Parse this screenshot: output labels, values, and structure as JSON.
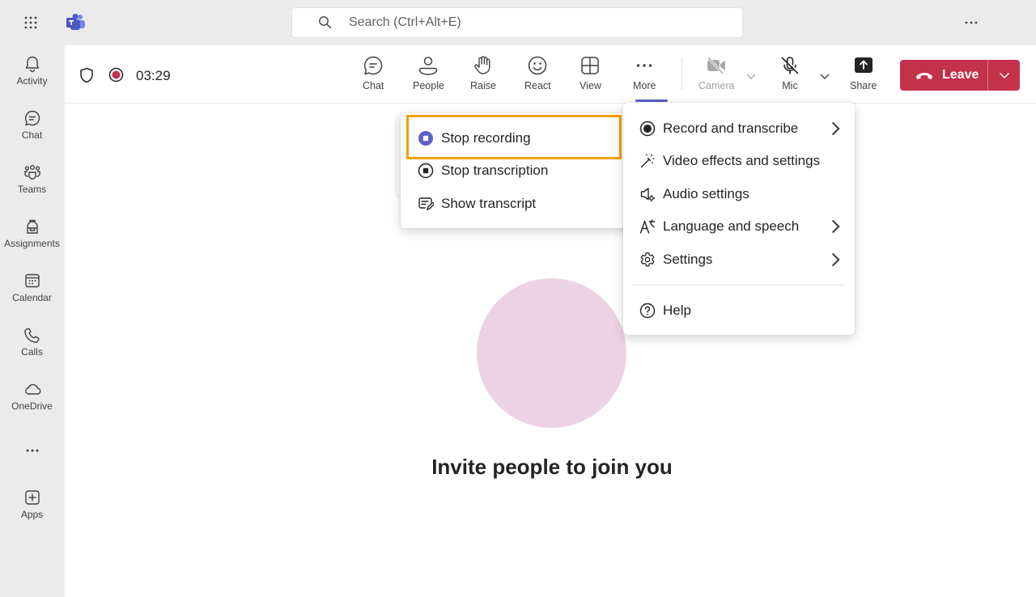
{
  "search": {
    "placeholder": "Search (Ctrl+Alt+E)"
  },
  "rail": {
    "items": [
      {
        "label": "Activity",
        "icon": "bell-icon"
      },
      {
        "label": "Chat",
        "icon": "chat-icon"
      },
      {
        "label": "Teams",
        "icon": "teams-icon"
      },
      {
        "label": "Assignments",
        "icon": "backpack-icon"
      },
      {
        "label": "Calendar",
        "icon": "calendar-icon"
      },
      {
        "label": "Calls",
        "icon": "phone-icon"
      },
      {
        "label": "OneDrive",
        "icon": "cloud-icon"
      },
      {
        "label": "",
        "icon": "more-icon"
      },
      {
        "label": "Apps",
        "icon": "add-apps-icon"
      }
    ]
  },
  "meeting": {
    "timer": "03:29",
    "toolbar": {
      "chat": "Chat",
      "people": "People",
      "raise": "Raise",
      "react": "React",
      "view": "View",
      "more": "More",
      "camera": "Camera",
      "mic": "Mic",
      "share": "Share",
      "leave": "Leave"
    },
    "invite_text": "Invite people to join you"
  },
  "record_submenu": {
    "items": [
      {
        "label": "Stop recording",
        "icon": "stop-recording-icon"
      },
      {
        "label": "Stop transcription",
        "icon": "stop-transcription-icon"
      },
      {
        "label": "Show transcript",
        "icon": "transcript-icon"
      }
    ]
  },
  "more_menu": {
    "items": [
      {
        "label": "Record and transcribe",
        "icon": "record-icon",
        "submenu": true
      },
      {
        "label": "Video effects and settings",
        "icon": "video-effects-icon",
        "submenu": false
      },
      {
        "label": "Audio settings",
        "icon": "audio-settings-icon",
        "submenu": false
      },
      {
        "label": "Language and speech",
        "icon": "language-icon",
        "submenu": true
      },
      {
        "label": "Settings",
        "icon": "gear-icon",
        "submenu": true
      },
      {
        "label": "Help",
        "icon": "help-icon",
        "submenu": false
      }
    ]
  },
  "colors": {
    "accent": "#5b5fc7",
    "leave": "#c4314b",
    "highlight": "#f0a000",
    "record": "#c4314b",
    "avatar": "#ecd3e3"
  }
}
